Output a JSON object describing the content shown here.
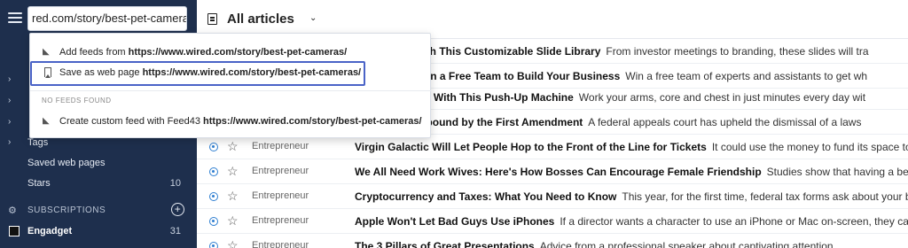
{
  "search": {
    "value": "red.com/story/best-pet-cameras/"
  },
  "sidebar": {
    "partial_chevrons": [
      "›",
      "›",
      "›"
    ],
    "items": [
      {
        "label": "Tags",
        "count": ""
      },
      {
        "label": "Saved web pages",
        "count": ""
      },
      {
        "label": "Stars",
        "count": "10"
      }
    ],
    "subscriptions_label": "SUBSCRIPTIONS",
    "feeds": [
      {
        "label": "Engadget",
        "count": "31"
      }
    ]
  },
  "header": {
    "title": "All articles"
  },
  "dropdown": {
    "add_feeds": {
      "prefix": "Add feeds from ",
      "url": "https://www.wired.com/story/best-pet-cameras/"
    },
    "save_page": {
      "prefix": "Save as web page ",
      "url": "https://www.wired.com/story/best-pet-cameras/"
    },
    "section_label": "NO FEEDS FOUND",
    "custom_feed": {
      "prefix": "Create custom feed with Feed43 ",
      "url": "https://www.wired.com/story/best-pet-cameras/"
    }
  },
  "articles": [
    {
      "source": "",
      "headline": "resentation with This Customizable Slide Library",
      "snippet": "From investor meetings to branding, these slides will tra"
    },
    {
      "source": "",
      "headline": "XT Contest: Win a Free Team to Build Your Business",
      "snippet": "Win a free team of experts and assistants to get wh"
    },
    {
      "source": "",
      "headline": "kout Anywhere With This Push-Up Machine",
      "snippet": "Work your arms, core and chest in just minutes every day wit"
    },
    {
      "source": "",
      "headline": "YouTube isn't bound by the First Amendment",
      "snippet": "A federal appeals court has upheld the dismissal of a laws"
    },
    {
      "source": "Entrepreneur",
      "headline": "Virgin Galactic Will Let People Hop to the Front of the Line for Tickets",
      "snippet": "It could use the money to fund its space tourism p"
    },
    {
      "source": "Entrepreneur",
      "headline": "We All Need Work Wives: Here's How Bosses Can Encourage Female Friendship",
      "snippet": "Studies show that having a best friend a"
    },
    {
      "source": "Entrepreneur",
      "headline": "Cryptocurrency and Taxes: What You Need to Know",
      "snippet": "This year, for the first time, federal tax forms ask about your bitcoin a"
    },
    {
      "source": "Entrepreneur",
      "headline": "Apple Won't Let Bad Guys Use iPhones",
      "snippet": "If a director wants a character to use an iPhone or Mac on-screen, they can't be a"
    },
    {
      "source": "Entrepreneur",
      "headline": "The 3 Pillars of Great Presentations",
      "snippet": "Advice from a professional speaker about captivating attention"
    }
  ]
}
